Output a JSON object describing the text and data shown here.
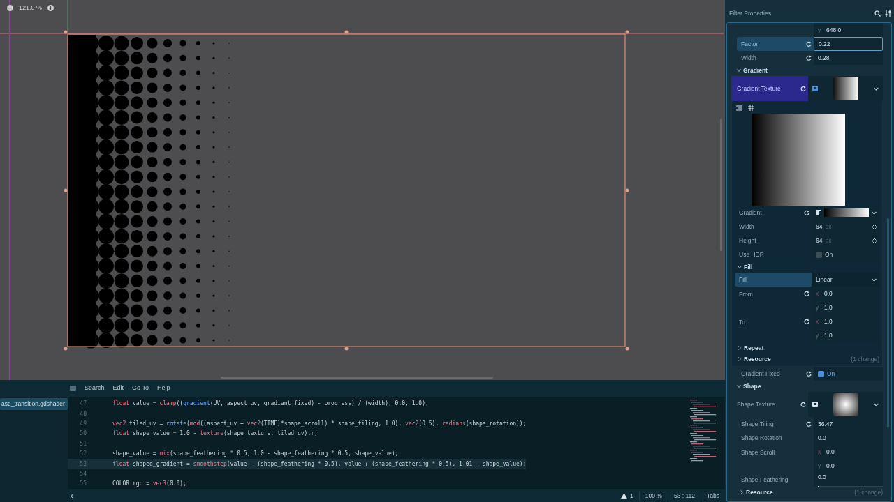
{
  "viewport": {
    "zoom": "121.0 %"
  },
  "code_editor": {
    "menu": [
      "Search",
      "Edit",
      "Go To",
      "Help"
    ],
    "files": [
      {
        "name": "ase_transition.gdshader",
        "selected": true
      }
    ],
    "lines": [
      {
        "number": "47",
        "current": false,
        "tokens": [
          {
            "text": "float",
            "kind": "keyword"
          },
          {
            "text": " value = ",
            "kind": "plain"
          },
          {
            "text": "clamp",
            "kind": "keyword"
          },
          {
            "text": "((",
            "kind": "plain"
          },
          {
            "text": "gradient",
            "kind": "function"
          },
          {
            "text": "(UV, aspect_uv, gradient_fixed) - progress) / (width), 0.0, 1.0);",
            "kind": "plain"
          }
        ]
      },
      {
        "number": "48",
        "current": false
      },
      {
        "number": "49",
        "current": false,
        "tokens": [
          {
            "text": "vec2",
            "kind": "keyword"
          },
          {
            "text": " tiled_uv = ",
            "kind": "plain"
          },
          {
            "text": "rotate",
            "kind": "function"
          },
          {
            "text": "(",
            "kind": "plain"
          },
          {
            "text": "mod",
            "kind": "keyword"
          },
          {
            "text": "((aspect_uv + ",
            "kind": "plain"
          },
          {
            "text": "vec2",
            "kind": "keyword"
          },
          {
            "text": "(TIME)*shape_scroll) * shape_tiling, 1.0), ",
            "kind": "plain"
          },
          {
            "text": "vec2",
            "kind": "keyword"
          },
          {
            "text": "(0.5), ",
            "kind": "plain"
          },
          {
            "text": "radians",
            "kind": "keyword"
          },
          {
            "text": "(shape_rotation));",
            "kind": "plain"
          }
        ]
      },
      {
        "number": "50",
        "current": false,
        "tokens": [
          {
            "text": "float",
            "kind": "keyword"
          },
          {
            "text": " shape_value = 1.0 - ",
            "kind": "plain"
          },
          {
            "text": "texture",
            "kind": "keyword"
          },
          {
            "text": "(shape_texture, tiled_uv).r;",
            "kind": "plain"
          }
        ]
      },
      {
        "number": "51",
        "current": false
      },
      {
        "number": "52",
        "current": false,
        "tokens": [
          {
            "text": "shape_value = ",
            "kind": "plain"
          },
          {
            "text": "mix",
            "kind": "keyword"
          },
          {
            "text": "(shape_feathering * 0.5, 1.0 - shape_feathering * 0.5, shape_value);",
            "kind": "plain"
          }
        ]
      },
      {
        "number": "53",
        "current": true,
        "tokens": [
          {
            "text": "float",
            "kind": "keyword"
          },
          {
            "text": " shaped_gradient = ",
            "kind": "plain"
          },
          {
            "text": "smoothstep",
            "kind": "keyword"
          },
          {
            "text": "(value - (shape_feathering * 0.5), value + (shape_feathering * 0.5), 1.01 - shape_value);",
            "kind": "plain"
          }
        ]
      },
      {
        "number": "54",
        "current": false
      },
      {
        "number": "55",
        "current": false,
        "tokens": [
          {
            "text": "COLOR.rgb = ",
            "kind": "plain"
          },
          {
            "text": "vec3",
            "kind": "keyword"
          },
          {
            "text": "(0.0);",
            "kind": "plain"
          }
        ]
      }
    ],
    "status": {
      "scroll_left": "‹",
      "warnings": "1",
      "zoom": "100 %",
      "position": "53 : 112",
      "indent": "Tabs"
    }
  },
  "inspector": {
    "filter": {
      "placeholder": "Filter Properties"
    },
    "rows": [
      {
        "kind": "vector",
        "label": "",
        "reset": false,
        "selected": false,
        "values": [
          {
            "axis": "y",
            "value": "648.0"
          }
        ]
      },
      {
        "kind": "number",
        "label": "Factor",
        "reset": true,
        "selected": true,
        "value": "0.22"
      },
      {
        "kind": "number",
        "label": "Width",
        "reset": true,
        "selected": false,
        "value": "0.28"
      },
      {
        "kind": "section",
        "label": "Gradient",
        "expanded": true
      },
      {
        "kind": "resource",
        "label": "Gradient Texture",
        "reset": true,
        "selected": true,
        "preview": {
          "kind": "linear"
        },
        "expanded": true,
        "children": [
          {
            "kind": "preview"
          },
          {
            "kind": "gradient",
            "label": "Gradient",
            "reset": true,
            "selected": false
          },
          {
            "kind": "size",
            "label": "Width",
            "reset": false,
            "selected": false,
            "value": "64",
            "unit": "px"
          },
          {
            "kind": "size",
            "label": "Height",
            "reset": false,
            "selected": false,
            "value": "64",
            "unit": "px"
          },
          {
            "kind": "checkbox",
            "label": "Use HDR",
            "reset": false,
            "selected": false,
            "checked": false,
            "text": "On"
          },
          {
            "kind": "group",
            "label": "Fill",
            "expanded": true,
            "children": [
              {
                "kind": "dropdown",
                "label": "Fill",
                "reset": false,
                "selected": true,
                "value": "Linear"
              },
              {
                "kind": "vector",
                "label": "From",
                "reset": true,
                "selected": false,
                "values": [
                  {
                    "axis": "x",
                    "value": "0.0"
                  },
                  {
                    "axis": "y",
                    "value": "1.0"
                  }
                ]
              },
              {
                "kind": "vector",
                "label": "To",
                "reset": true,
                "selected": false,
                "values": [
                  {
                    "axis": "x",
                    "value": "1.0"
                  },
                  {
                    "axis": "y",
                    "value": "1.0"
                  }
                ]
              }
            ]
          },
          {
            "kind": "group",
            "label": "Repeat",
            "expanded": false
          },
          {
            "kind": "group",
            "label": "Resource",
            "expanded": false,
            "note": "(1 change)"
          }
        ]
      },
      {
        "kind": "checkbox",
        "label": "Gradient Fixed",
        "reset": true,
        "selected": false,
        "checked": true,
        "text": "On"
      },
      {
        "kind": "section",
        "label": "Shape",
        "expanded": true
      },
      {
        "kind": "resource",
        "label": "Shape Texture",
        "reset": true,
        "selected": false,
        "preview": {
          "kind": "radial"
        }
      },
      {
        "kind": "number",
        "label": "Shape Tiling",
        "reset": true,
        "selected": false,
        "value": "36.47"
      },
      {
        "kind": "number",
        "label": "Shape Rotation",
        "reset": false,
        "selected": false,
        "value": "0.0"
      },
      {
        "kind": "vector",
        "label": "Shape Scroll",
        "reset": false,
        "selected": false,
        "values": [
          {
            "axis": "x",
            "value": "0.0"
          },
          {
            "axis": "y",
            "value": "0.0"
          }
        ]
      },
      {
        "kind": "slider",
        "label": "Shape Feathering",
        "reset": false,
        "selected": false,
        "value": "0.0",
        "level": 0
      },
      {
        "kind": "group",
        "label": "Resource",
        "expanded": false,
        "note": "(1 change)"
      }
    ]
  }
}
